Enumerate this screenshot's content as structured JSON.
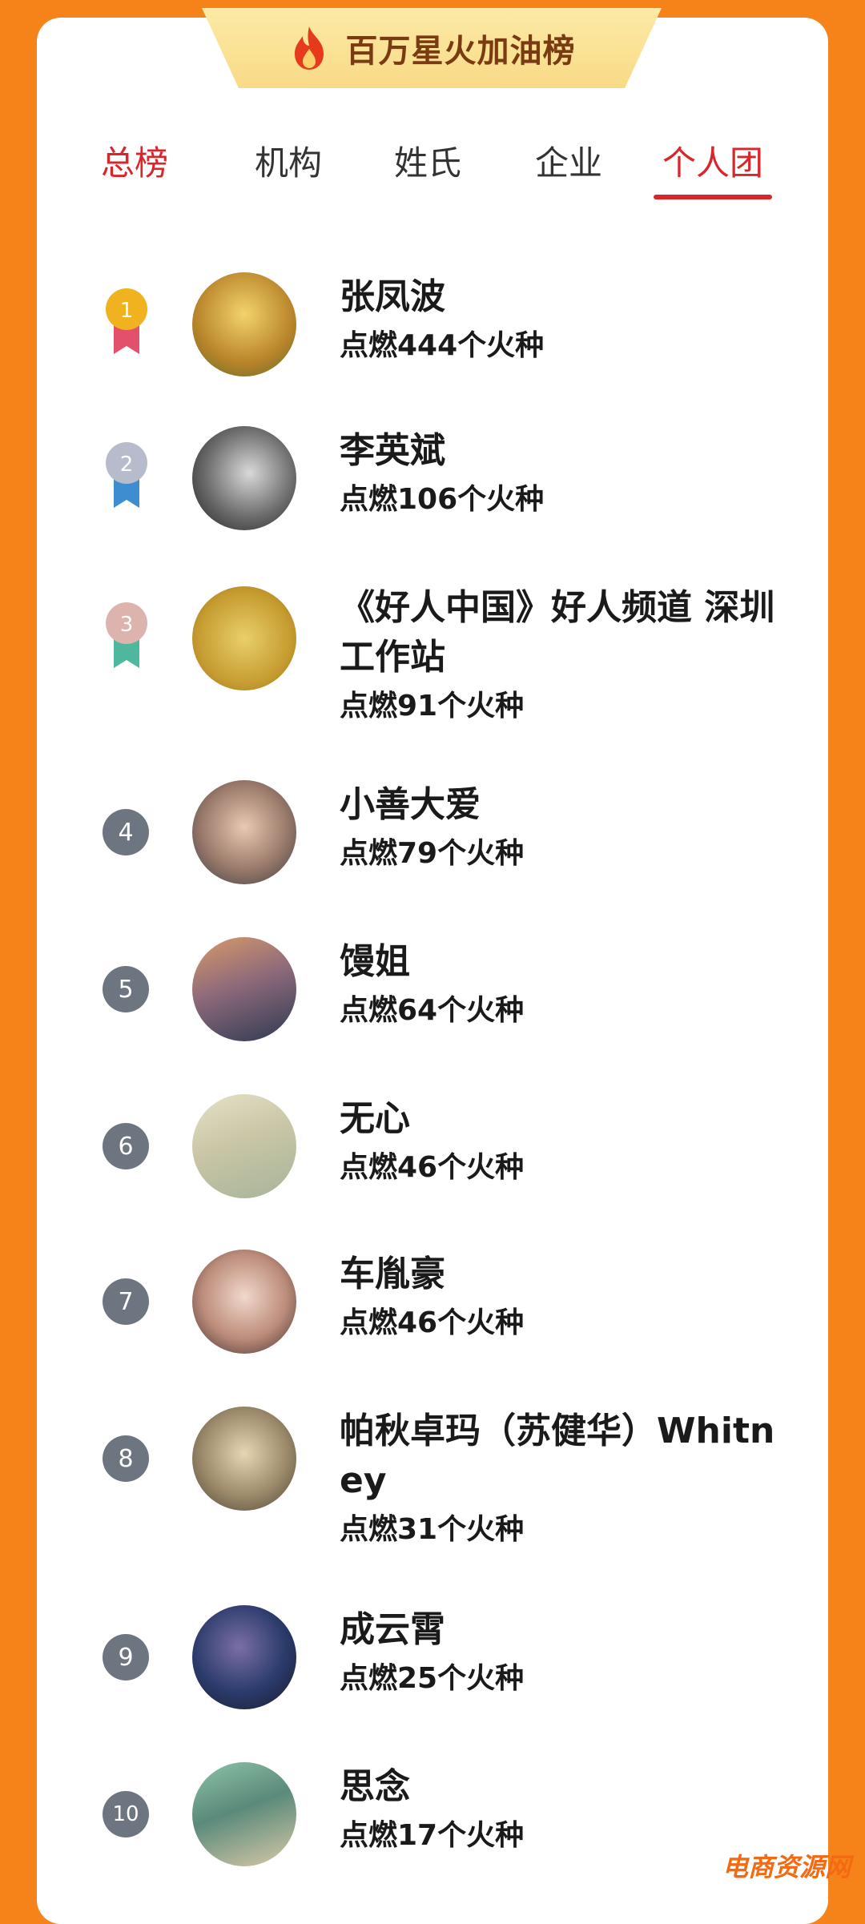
{
  "header": {
    "title": "百万星火加油榜"
  },
  "tabs": [
    {
      "label": "总榜",
      "active": false
    },
    {
      "label": "机构",
      "active": false
    },
    {
      "label": "姓氏",
      "active": false
    },
    {
      "label": "企业",
      "active": false
    },
    {
      "label": "个人团",
      "active": true
    }
  ],
  "colors": {
    "background": "#F58319",
    "accent_red": "#D8262B",
    "banner": "#F9DA86"
  },
  "rankings": [
    {
      "rank": "1",
      "name": "张凤波",
      "count": "点燃444个火种",
      "badge": "gold-medal"
    },
    {
      "rank": "2",
      "name": "李英斌",
      "count": "点燃106个火种",
      "badge": "silver-medal"
    },
    {
      "rank": "3",
      "name": "《好人中国》好人频道 深圳工作站",
      "count": "点燃91个火种",
      "badge": "bronze-medal"
    },
    {
      "rank": "4",
      "name": "小善大爱",
      "count": "点燃79个火种"
    },
    {
      "rank": "5",
      "name": "馒姐",
      "count": "点燃64个火种"
    },
    {
      "rank": "6",
      "name": "无心",
      "count": "点燃46个火种"
    },
    {
      "rank": "7",
      "name": "车胤豪",
      "count": "点燃46个火种"
    },
    {
      "rank": "8",
      "name": "帕秋卓玛（苏健华）Whitney",
      "count": "点燃31个火种"
    },
    {
      "rank": "9",
      "name": "成云霄",
      "count": "点燃25个火种"
    },
    {
      "rank": "10",
      "name": "思念",
      "count": "点燃17个火种"
    }
  ],
  "watermark": "电商资源网"
}
